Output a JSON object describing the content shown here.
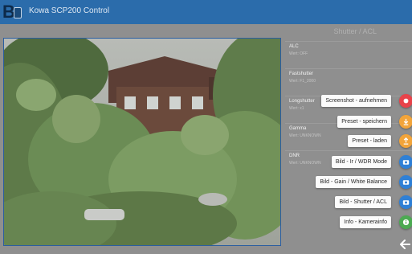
{
  "window": {
    "title": "Kowa SCP200 Control"
  },
  "panel": {
    "header": "Shutter / ACL"
  },
  "settings": [
    {
      "name": "ALC",
      "value": "Wert: OFF"
    },
    {
      "name": "Fastshutter",
      "value": "Wert: F1_2000"
    },
    {
      "name": "Longshutter",
      "value": "Wert: x1"
    },
    {
      "name": "Gamma",
      "value": "Wert: UNKNOWN"
    },
    {
      "name": "DNR",
      "value": "Wert: UNKNOWN"
    }
  ],
  "actions": [
    {
      "label": "Screenshot - aufnehmen",
      "icon": "record-icon",
      "color": "#e8434a"
    },
    {
      "label": "Preset - speichern",
      "icon": "download-icon",
      "color": "#f2a43a"
    },
    {
      "label": "Preset - laden",
      "icon": "upload-icon",
      "color": "#f2a43a"
    },
    {
      "label": "Bild - Ir / WDR Mode",
      "icon": "camera-icon",
      "color": "#2f80d6"
    },
    {
      "label": "Bild - Gain / White Balance",
      "icon": "camera-icon",
      "color": "#2f80d6"
    },
    {
      "label": "Bild - Shutter / ACL",
      "icon": "camera-icon",
      "color": "#2f80d6"
    },
    {
      "label": "Info - Kamerainfo",
      "icon": "info-icon",
      "color": "#4caa52"
    }
  ],
  "colors": {
    "titlebar": "#2b6cab",
    "background": "#8f8f8f"
  }
}
